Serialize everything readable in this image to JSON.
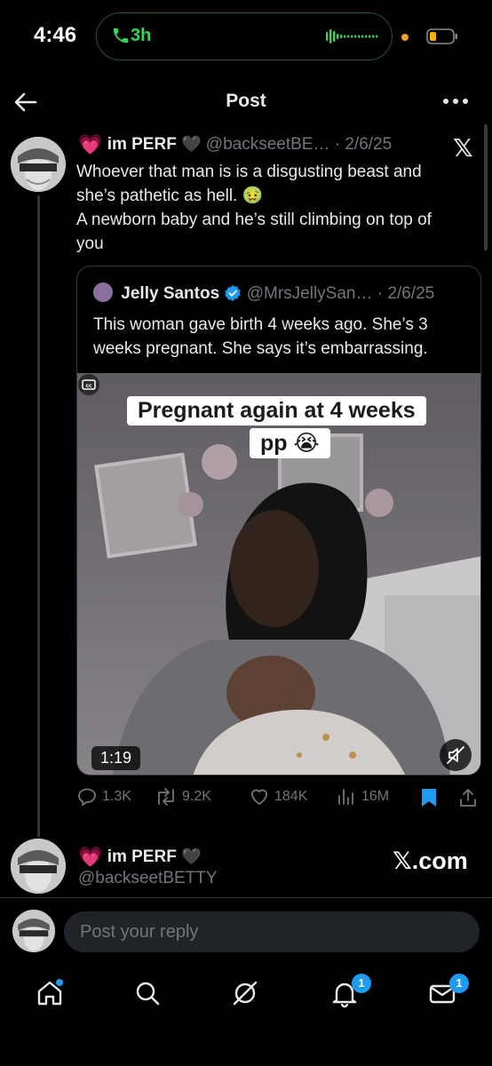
{
  "status_bar": {
    "time": "4:46",
    "call_duration": "3h"
  },
  "header": {
    "title": "Post"
  },
  "tweet": {
    "author_name": "im PERF",
    "handle_date": "@backseetBE… · 2/6/25",
    "text_lines": [
      "Whoever that man is is a disgusting beast and",
      "she’s pathetic as hell. 🤢",
      "A newborn baby and he’s still climbing on top of",
      "you"
    ]
  },
  "quote": {
    "author_name": "Jelly Santos",
    "handle_date": "@MrsJellySan… · 2/6/25",
    "text_lines": [
      "This woman gave birth 4 weeks ago. She’s 3",
      "weeks pregnant. She says it’s embarrassing."
    ],
    "media": {
      "caption_line1": "Pregnant again at 4 weeks",
      "caption_line2": "pp 😭",
      "duration": "1:19"
    }
  },
  "actions": {
    "replies": "1.3K",
    "reposts": "9.2K",
    "likes": "184K",
    "views": "16M"
  },
  "reply_tweet": {
    "author_name": "im PERF",
    "handle": "@backseetBETTY",
    "watermark": "𝕏.com"
  },
  "reply_bar": {
    "placeholder": "Post your reply"
  },
  "bottom_nav": {
    "notifications_badge": "1",
    "messages_badge": "1"
  },
  "colors": {
    "background": "#000000",
    "accent": "#1d9bf0",
    "text": "#e7e9ea",
    "muted": "#71767b",
    "heart": "#e0438f",
    "call_green": "#35d45a"
  }
}
